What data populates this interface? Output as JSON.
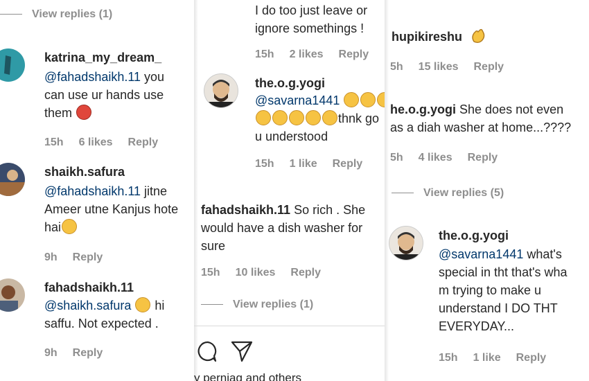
{
  "panel1": {
    "top_view_replies": "View replies (1)",
    "comments": [
      {
        "user": "katrina_my_dream_",
        "mention": "@fahadshaikh.11",
        "text1": " you",
        "text2": "can use ur hands use",
        "text3": "them",
        "time": "15h",
        "likes": "6 likes",
        "reply": "Reply"
      },
      {
        "user": "shaikh.safura",
        "mention": "@fahadshaikh.11",
        "text1": " jitne",
        "text2": "Ameer utne Kanjus hote",
        "text3": "hai",
        "time": "9h",
        "reply": "Reply"
      },
      {
        "user": "fahadshaikh.11",
        "mention": "@shaikh.safura",
        "text1": " hi",
        "text2": "saffu. Not expected .",
        "time": "9h",
        "reply": "Reply"
      }
    ]
  },
  "panel2": {
    "top_text1": "I do too just leave or",
    "top_text2": "ignore somethings !",
    "top_meta": {
      "time": "15h",
      "likes": "2 likes",
      "reply": "Reply"
    },
    "yogi": {
      "user": "the.o.g.yogi",
      "mention": "@savarna1441",
      "text2": "thnk go",
      "text3": "u understood",
      "time": "15h",
      "likes": "1 like",
      "reply": "Reply"
    },
    "fahad": {
      "user": "fahadshaikh.11",
      "text1": " So rich . She",
      "text2": "would have a dish washer for",
      "text3": "sure",
      "time": "15h",
      "likes": "10 likes",
      "reply": "Reply"
    },
    "view_replies": "View replies (1)",
    "footer_text": "y perniag and others"
  },
  "panel3": {
    "c1": {
      "user": "hupikireshu",
      "time": "5h",
      "likes": "15 likes",
      "reply": "Reply"
    },
    "c2": {
      "line1_user": "he.o.g.yogi",
      "line1_text": " She does not even",
      "line2": "as a diah washer at home...????",
      "time": "5h",
      "likes": "4 likes",
      "reply": "Reply"
    },
    "view_replies": "View replies (5)",
    "c3": {
      "user": "the.o.g.yogi",
      "mention": "@savarna1441",
      "text1": " what's",
      "text2": "special in tht that's wha",
      "text3": "m trying to make u",
      "text4": "understand I DO THT",
      "text5": "EVERYDAY...",
      "time": "15h",
      "likes": "1 like",
      "reply": "Reply"
    }
  },
  "colors": {
    "text": "#262626",
    "muted": "#8e8e8e",
    "mention": "#00376b"
  }
}
